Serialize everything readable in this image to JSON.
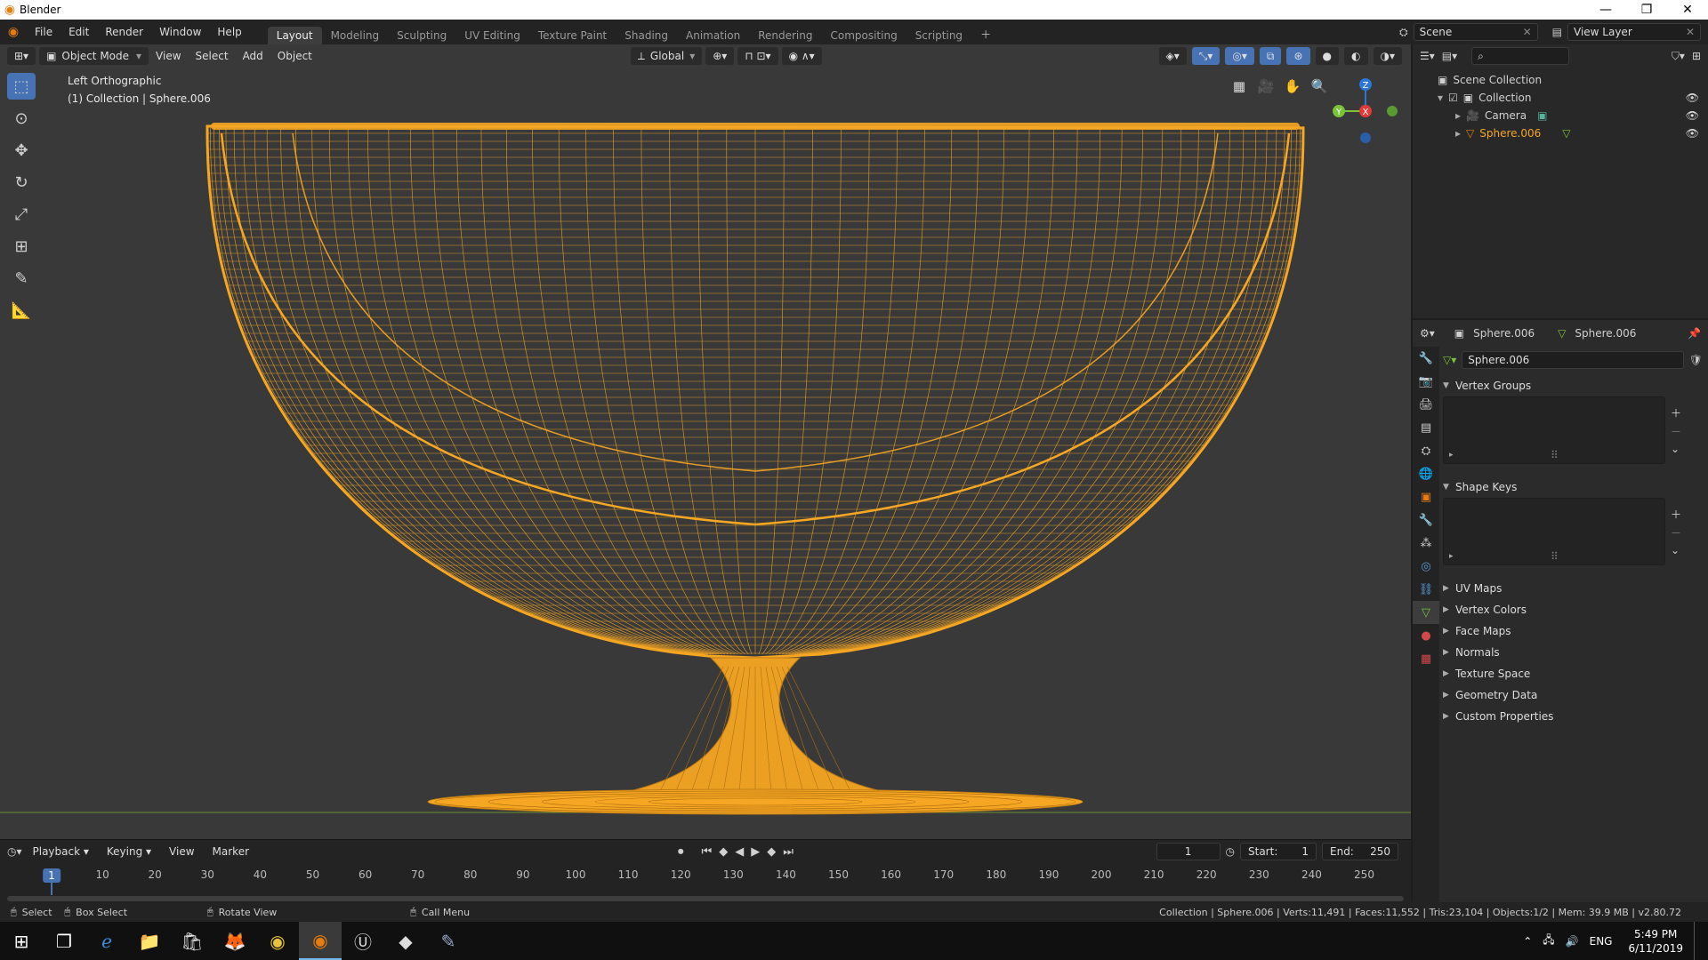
{
  "window": {
    "title": "Blender",
    "controls": [
      "—",
      "❐",
      "✕"
    ]
  },
  "menus": [
    "File",
    "Edit",
    "Render",
    "Window",
    "Help"
  ],
  "workspaces": [
    {
      "label": "Layout",
      "active": true
    },
    {
      "label": "Modeling"
    },
    {
      "label": "Sculpting"
    },
    {
      "label": "UV Editing"
    },
    {
      "label": "Texture Paint"
    },
    {
      "label": "Shading"
    },
    {
      "label": "Animation"
    },
    {
      "label": "Rendering"
    },
    {
      "label": "Compositing"
    },
    {
      "label": "Scripting"
    }
  ],
  "scene": {
    "name": "Scene",
    "view_layer": "View Layer"
  },
  "viewport": {
    "mode": "Object Mode",
    "menus": [
      "View",
      "Select",
      "Add",
      "Object"
    ],
    "orientation": "Global",
    "view_name": "Left Orthographic",
    "collection_info": "(1) Collection | Sphere.006",
    "axis_z": "Z",
    "axis_y": "Y",
    "axis_x": "X",
    "wire_color": "#f5a623",
    "bg_color": "#393939"
  },
  "outliner": {
    "root": "Scene Collection",
    "collection": "Collection",
    "items": [
      {
        "label": "Camera"
      },
      {
        "label": "Sphere.006",
        "selected": true
      }
    ]
  },
  "properties": {
    "object_name": "Sphere.006",
    "data_name": "Sphere.006",
    "mesh_name": "Sphere.006",
    "open_panels": [
      "Vertex Groups",
      "Shape Keys"
    ],
    "closed_panels": [
      "UV Maps",
      "Vertex Colors",
      "Face Maps",
      "Normals",
      "Texture Space",
      "Geometry Data",
      "Custom Properties"
    ]
  },
  "timeline": {
    "menus": [
      "Playback",
      "Keying",
      "View",
      "Marker"
    ],
    "current_frame": "1",
    "start_label": "Start:",
    "start": "1",
    "end_label": "End:",
    "end": "250",
    "ticks": [
      "1",
      "10",
      "20",
      "30",
      "40",
      "50",
      "60",
      "70",
      "80",
      "90",
      "100",
      "110",
      "120",
      "130",
      "140",
      "150",
      "160",
      "170",
      "180",
      "190",
      "200",
      "210",
      "220",
      "230",
      "240",
      "250"
    ]
  },
  "statusbar": {
    "select": "Select",
    "box_select": "Box Select",
    "rotate_view": "Rotate View",
    "call_menu": "Call Menu",
    "stats": "Collection | Sphere.006 | Verts:11,491 | Faces:11,552 | Tris:23,104 | Objects:1/2 | Mem: 39.9 MB | v2.80.72"
  },
  "taskbar": {
    "lang": "ENG",
    "time": "5:49 PM",
    "date": "6/11/2019"
  }
}
